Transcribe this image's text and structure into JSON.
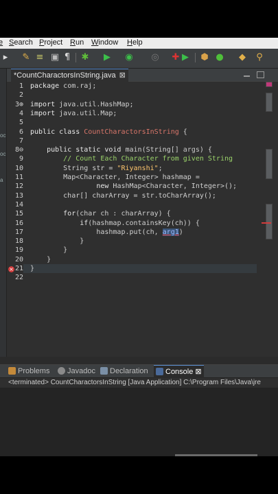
{
  "menu": {
    "items": [
      "e",
      "Search",
      "Project",
      "Run",
      "Window",
      "Help"
    ]
  },
  "toolbar": {
    "icons": [
      "pencil-icon",
      "format-icon",
      "paragraph-icon",
      "bug-icon",
      "run-icon",
      "coverage-icon",
      "stop-icon",
      "external-tools-icon",
      "new-package-icon",
      "new-class-icon",
      "search-icon"
    ]
  },
  "editor": {
    "tab_title": "*CountCharactorsInString.java",
    "tab_close": "⊠",
    "lines": [
      {
        "n": "1",
        "parts": [
          [
            "kw",
            "package "
          ],
          [
            "ty",
            "com.raj;"
          ]
        ]
      },
      {
        "n": "2",
        "parts": []
      },
      {
        "n": "3⊕",
        "parts": [
          [
            "kw",
            "import "
          ],
          [
            "ty",
            "java.util.HashMap;"
          ]
        ]
      },
      {
        "n": "4",
        "parts": [
          [
            "kw",
            "import "
          ],
          [
            "ty",
            "java.util.Map;"
          ]
        ]
      },
      {
        "n": "5",
        "parts": []
      },
      {
        "n": "6",
        "parts": [
          [
            "kw",
            "public class "
          ],
          [
            "cl",
            "CountCharactorsInString"
          ],
          [
            "ty",
            " {"
          ]
        ]
      },
      {
        "n": "7",
        "parts": []
      },
      {
        "n": "8⊖",
        "parts": [
          [
            "kw",
            "    public static void "
          ],
          [
            "ty",
            "main(String[] "
          ],
          [
            "ar",
            "args"
          ],
          [
            "ty",
            ") {"
          ]
        ]
      },
      {
        "n": "9",
        "parts": [
          [
            "com",
            "        // Count Each Character from given String"
          ]
        ]
      },
      {
        "n": "10",
        "parts": [
          [
            "ty",
            "        String str = "
          ],
          [
            "str",
            "\"Riyanshi\""
          ],
          [
            "ty",
            ";"
          ]
        ]
      },
      {
        "n": "11",
        "parts": [
          [
            "ty",
            "        Map<Character, Integer> hashmap ="
          ]
        ]
      },
      {
        "n": "12",
        "parts": [
          [
            "kw",
            "                new "
          ],
          [
            "ty",
            "HashMap<Character, Integer>();"
          ]
        ]
      },
      {
        "n": "13",
        "parts": [
          [
            "ty",
            "        char[] charArray = str.toCharArray();"
          ]
        ]
      },
      {
        "n": "14",
        "parts": []
      },
      {
        "n": "15",
        "parts": [
          [
            "kw",
            "        for"
          ],
          [
            "ty",
            "(char ch : charArray) {"
          ]
        ]
      },
      {
        "n": "16",
        "parts": [
          [
            "kw",
            "            if"
          ],
          [
            "ty",
            "(hashmap.containsKey(ch)) {"
          ]
        ]
      },
      {
        "n": "17",
        "parts": [
          [
            "ty",
            "                hashmap.put(ch, "
          ],
          [
            "sel",
            "arg1"
          ],
          [
            "ty",
            ")"
          ]
        ]
      },
      {
        "n": "18",
        "parts": [
          [
            "ty",
            "            }"
          ]
        ]
      },
      {
        "n": "19",
        "parts": [
          [
            "ty",
            "        }"
          ]
        ]
      },
      {
        "n": "20",
        "parts": [
          [
            "ty",
            "    }"
          ]
        ]
      },
      {
        "n": "21",
        "parts": [
          [
            "ty",
            "}"
          ]
        ]
      },
      {
        "n": "22",
        "parts": []
      }
    ]
  },
  "leftstrip": {
    "labels": [
      "oc",
      "oc",
      "a"
    ]
  },
  "bottom_panel": {
    "tabs": [
      {
        "label": "Problems",
        "icon": "problems-icon"
      },
      {
        "label": "Javadoc",
        "icon": "javadoc-icon"
      },
      {
        "label": "Declaration",
        "icon": "declaration-icon"
      },
      {
        "label": "Console",
        "icon": "console-icon",
        "active": true,
        "close": "⊠"
      }
    ],
    "console_header": "<terminated> CountCharactorsInString [Java Application] C:\\Program Files\\Java\\jre"
  },
  "colors": {
    "error": "#d23c3c",
    "class_name": "#d9766a",
    "string": "#ffc66d",
    "comment": "#9bd36a"
  }
}
